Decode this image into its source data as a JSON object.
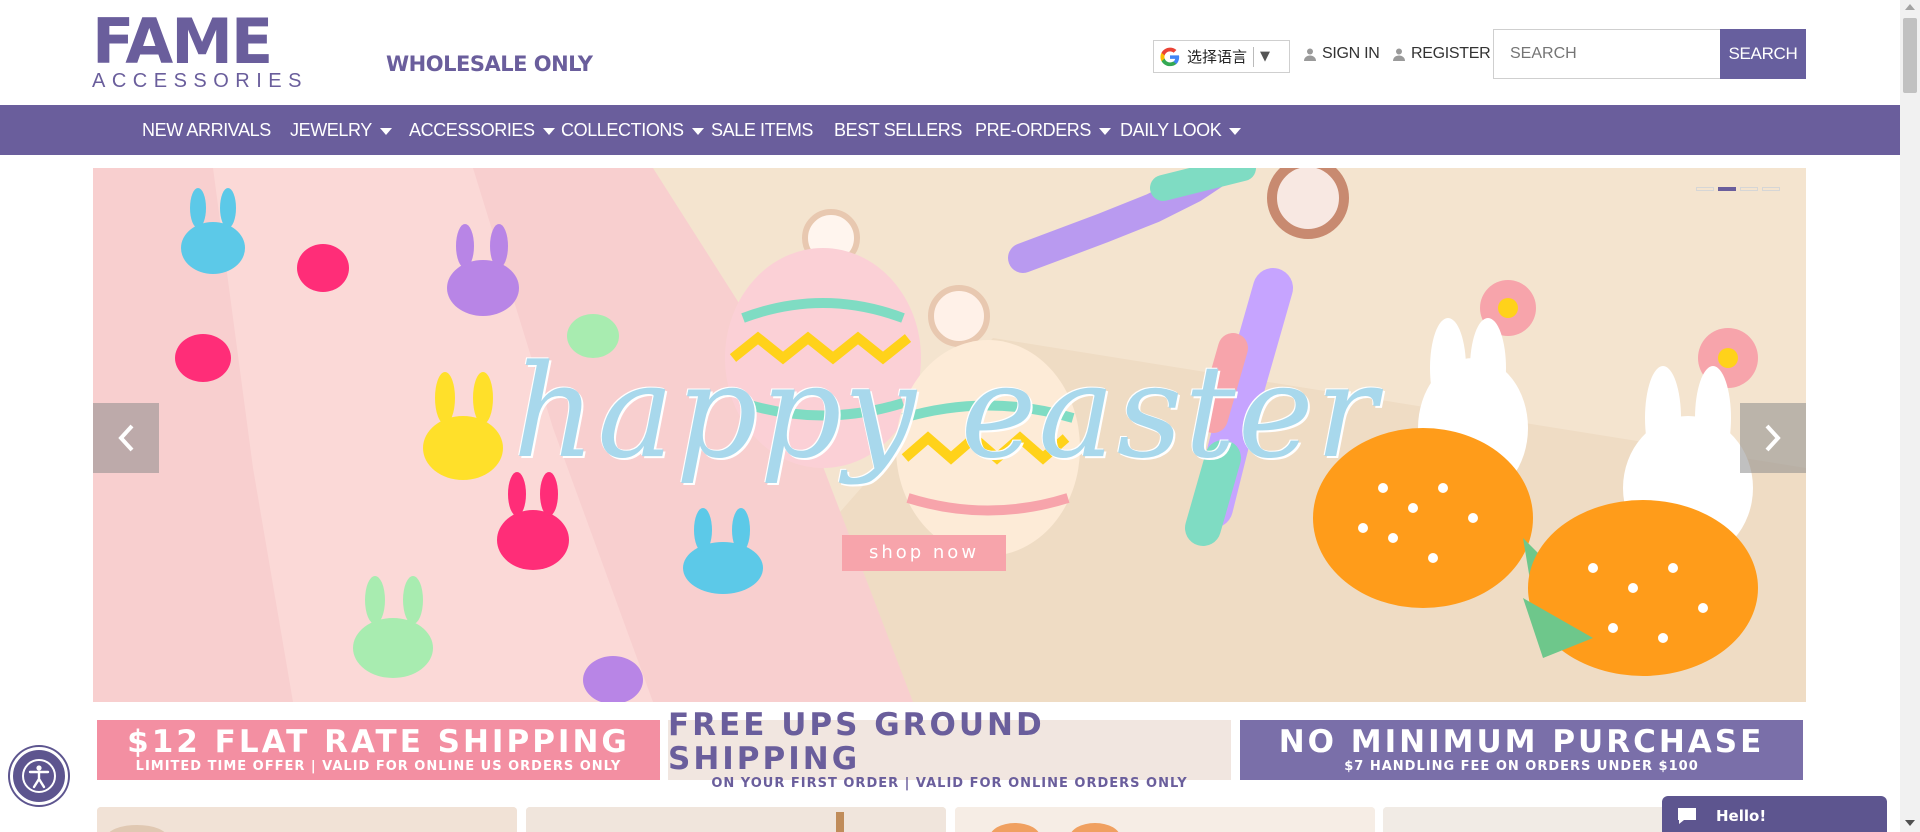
{
  "brand": {
    "logo_text": "FAME",
    "logo_subtext": "ACCESSORIES",
    "tagline": "WHOLESALE ONLY"
  },
  "header": {
    "language_label": "选择语言",
    "sign_in": "SIGN IN",
    "register": "REGISTER",
    "search_placeholder": "SEARCH",
    "search_button": "SEARCH"
  },
  "nav": {
    "items": [
      {
        "label": "NEW ARRIVALS",
        "dropdown": false
      },
      {
        "label": "JEWELRY",
        "dropdown": true
      },
      {
        "label": "ACCESSORIES",
        "dropdown": true
      },
      {
        "label": "COLLECTIONS",
        "dropdown": true
      },
      {
        "label": "SALE ITEMS",
        "dropdown": false
      },
      {
        "label": "BEST SELLERS",
        "dropdown": false
      },
      {
        "label": "PRE-ORDERS",
        "dropdown": true
      },
      {
        "label": "DAILY LOOK",
        "dropdown": true
      }
    ]
  },
  "hero": {
    "title": "happy easter",
    "cta": "shop now",
    "slide_count": 4,
    "active_slide": 2
  },
  "promos": [
    {
      "headline": "$12 FLAT RATE SHIPPING",
      "subline": "LIMITED TIME OFFER | VALID FOR ONLINE US ORDERS ONLY"
    },
    {
      "headline": "FREE UPS GROUND SHIPPING",
      "subline": "ON YOUR FIRST ORDER | VALID FOR ONLINE ORDERS ONLY"
    },
    {
      "headline": "NO MINIMUM PURCHASE",
      "subline": "$7 HANDLING FEE ON ORDERS UNDER $100"
    }
  ],
  "chat": {
    "label": "Hello!"
  },
  "colors": {
    "brand_purple": "#6a5e9c",
    "brand_pink": "#f08ea6",
    "promo_pink": "#f38fa2",
    "promo_cream": "#f1e6e0",
    "promo_purple": "#7a6fa9"
  }
}
